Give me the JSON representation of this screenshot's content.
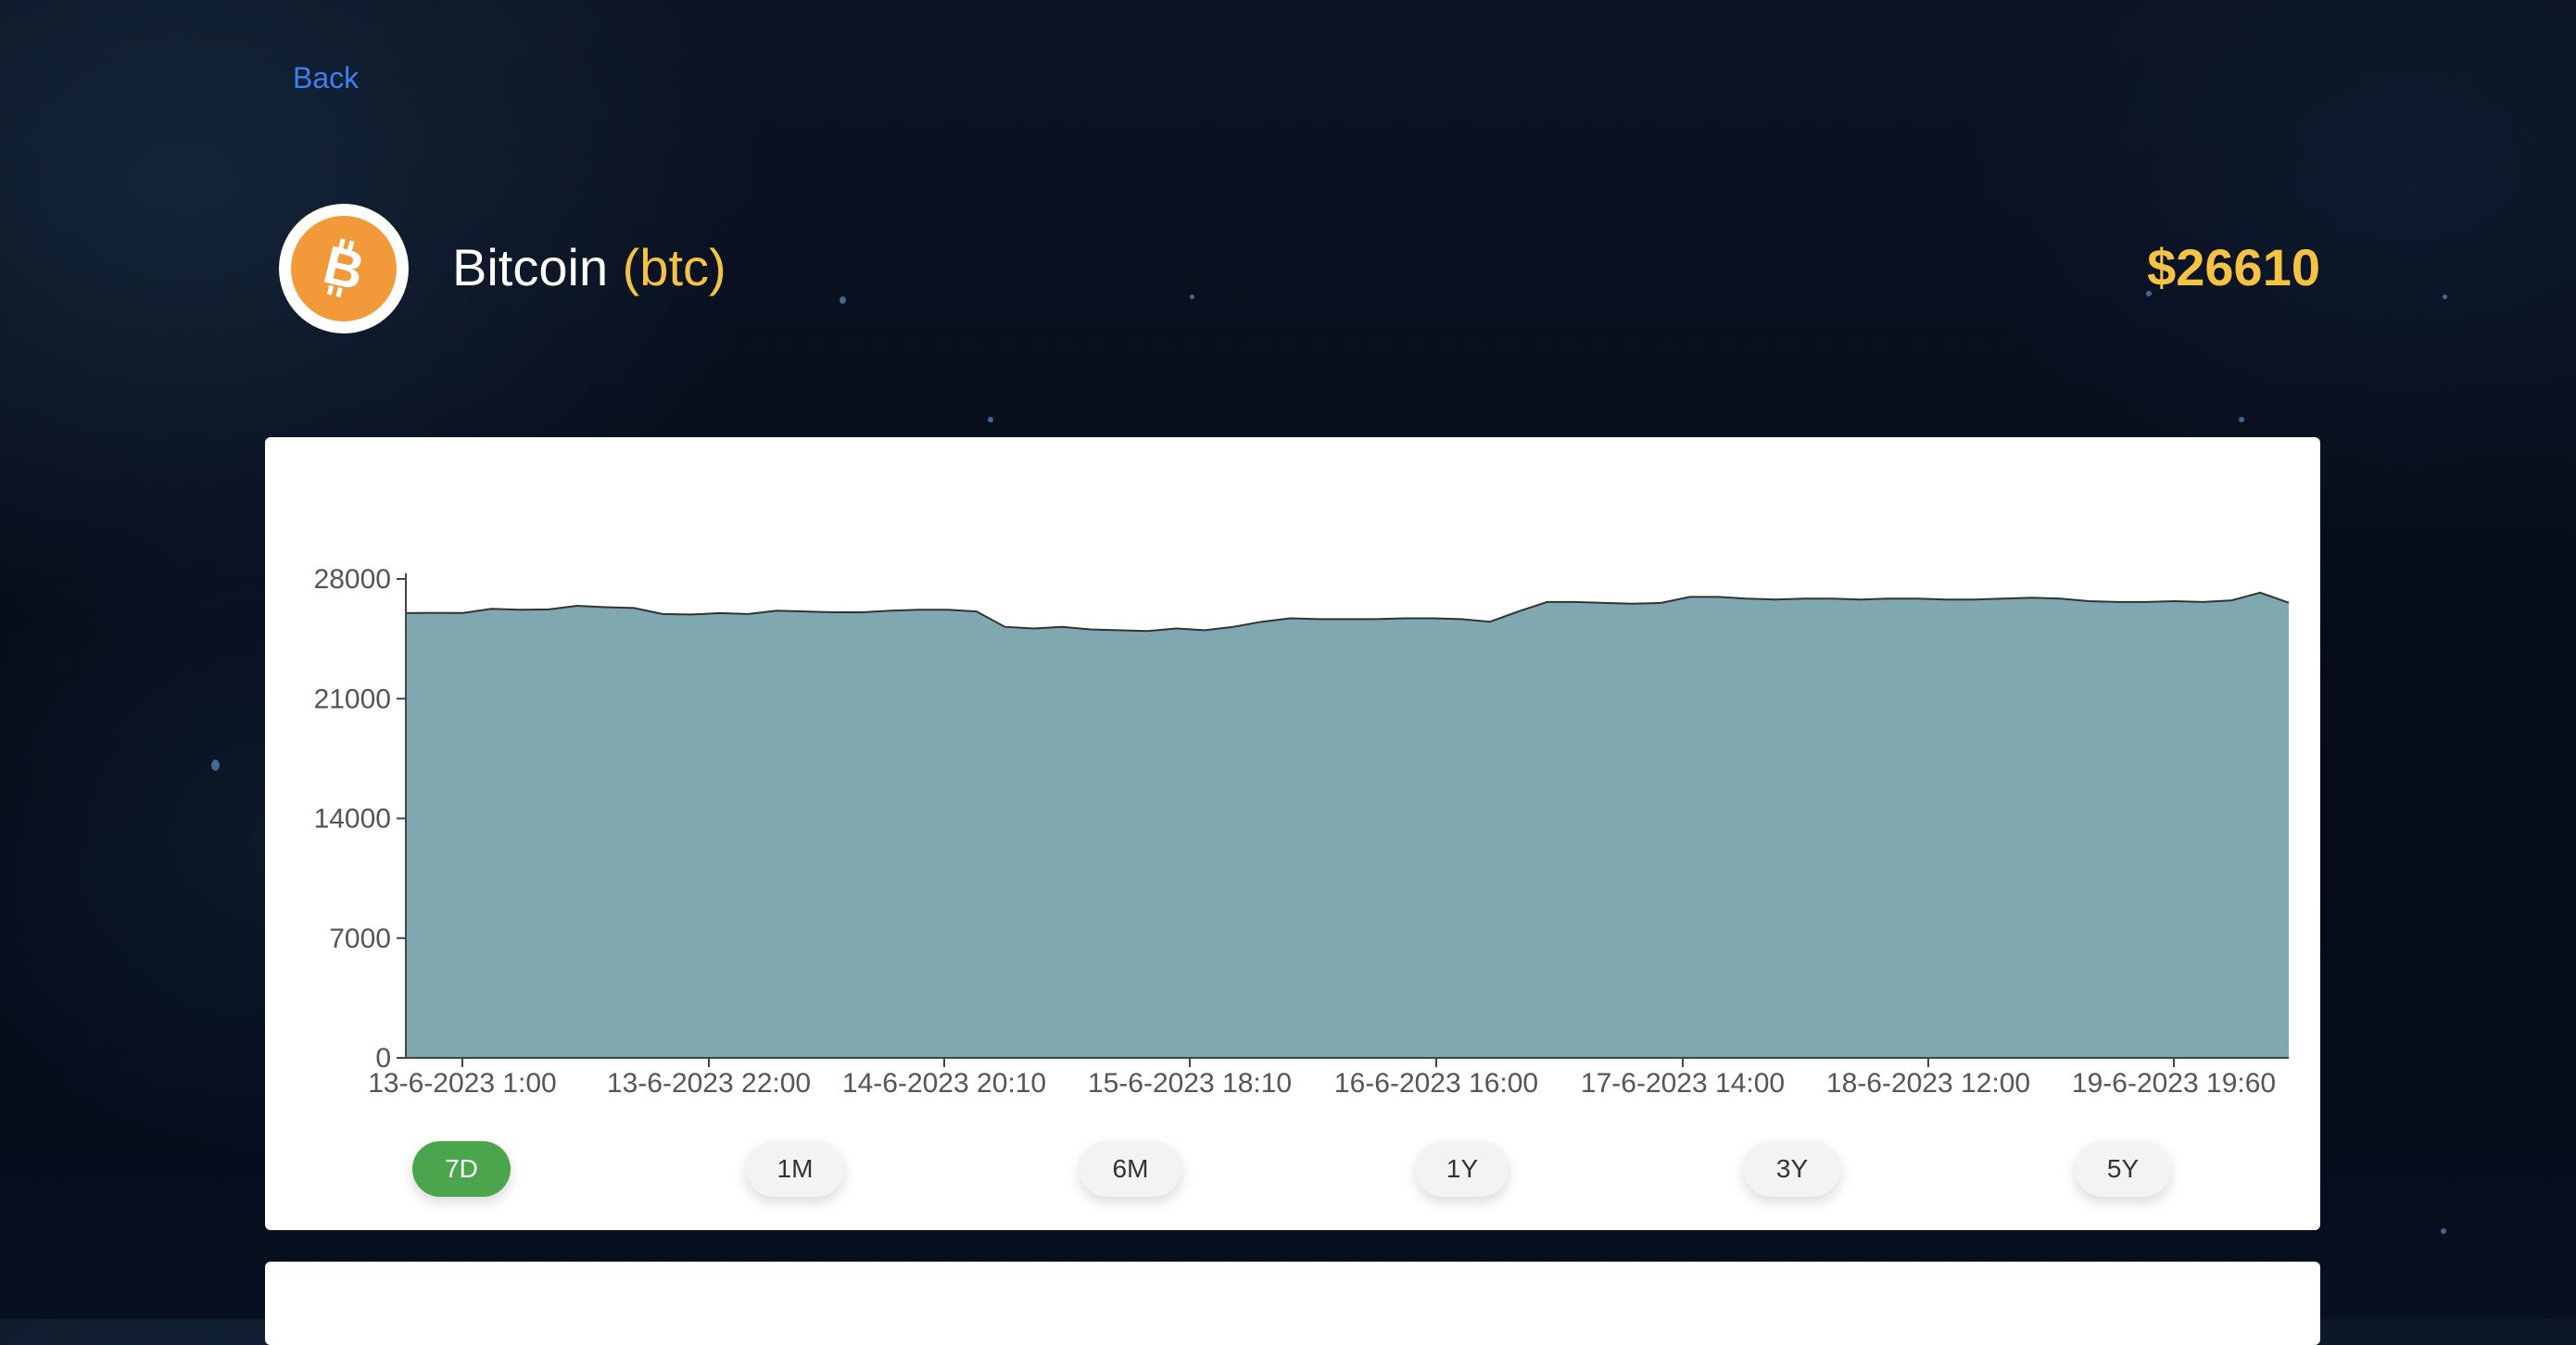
{
  "nav": {
    "back_label": "Back"
  },
  "coin": {
    "name": "Bitcoin",
    "symbol": "(btc)",
    "price": "$26610",
    "logo_icon": "bitcoin-icon",
    "logo_color": "#f2993a"
  },
  "range_buttons": [
    {
      "label": "7D",
      "active": true
    },
    {
      "label": "1M",
      "active": false
    },
    {
      "label": "6M",
      "active": false
    },
    {
      "label": "1Y",
      "active": false
    },
    {
      "label": "3Y",
      "active": false
    },
    {
      "label": "5Y",
      "active": false
    }
  ],
  "colors": {
    "accent": "#3d7ff5",
    "price": "#f6c244",
    "area_fill": "#80a8b0",
    "active_button": "#4aa54c"
  },
  "chart_data": {
    "type": "area",
    "ylim": [
      0,
      28000
    ],
    "y_ticks": [
      0,
      7000,
      14000,
      21000,
      28000
    ],
    "x_ticks": [
      "13-6-2023 1:00",
      "13-6-2023 22:00",
      "14-6-2023 20:10",
      "15-6-2023 18:10",
      "16-6-2023 16:00",
      "17-6-2023 14:00",
      "18-6-2023 12:00",
      "19-6-2023 19:60"
    ],
    "grid": false,
    "values": [
      26000,
      26020,
      26010,
      26250,
      26200,
      26220,
      26430,
      26350,
      26300,
      25950,
      25920,
      26000,
      25950,
      26150,
      26100,
      26050,
      26050,
      26150,
      26200,
      26200,
      26100,
      25200,
      25100,
      25200,
      25050,
      25000,
      24950,
      25100,
      25000,
      25200,
      25500,
      25700,
      25650,
      25650,
      25650,
      25700,
      25700,
      25650,
      25500,
      26100,
      26650,
      26650,
      26600,
      26550,
      26600,
      26950,
      26950,
      26850,
      26800,
      26850,
      26850,
      26800,
      26850,
      26850,
      26800,
      26800,
      26850,
      26900,
      26850,
      26700,
      26650,
      26650,
      26700,
      26650,
      26750,
      27200,
      26610
    ]
  }
}
